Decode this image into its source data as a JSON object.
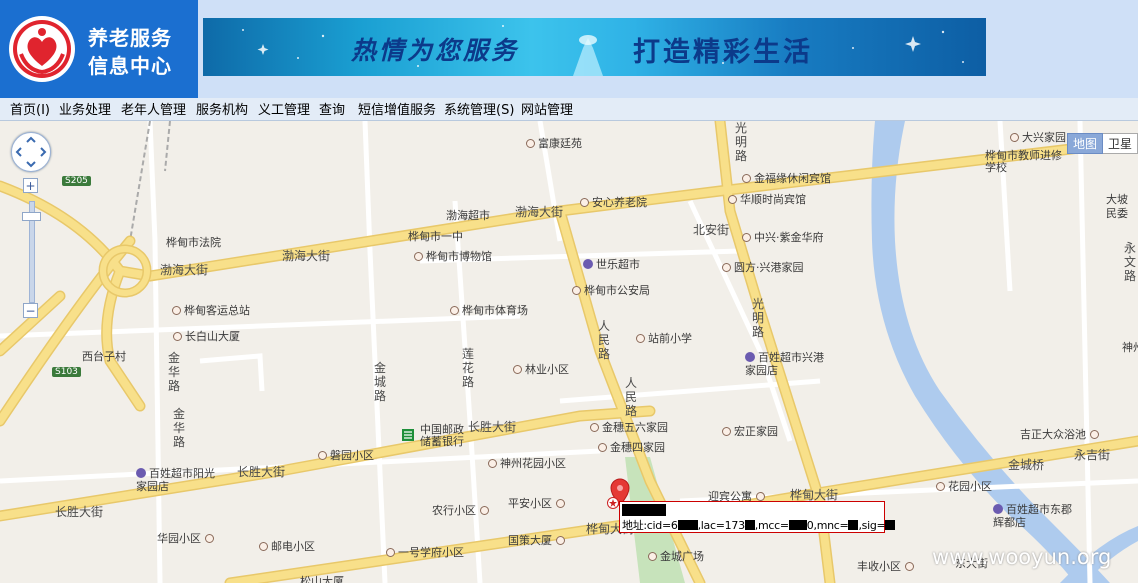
{
  "header": {
    "logo_line1": "养老服务",
    "logo_line2": "信息中心",
    "slogan_left": "热情为您服务",
    "slogan_right": "打造精彩生活"
  },
  "nav": [
    "首页(I)",
    "业务处理",
    "老年人管理",
    "服务机构",
    "义工管理",
    "查询",
    "短信增值服务",
    "系统管理(S)",
    "网站管理"
  ],
  "map": {
    "map_type": "地图",
    "satellite": "卫星",
    "zoom_in": "+",
    "zoom_out": "−",
    "pois": [
      "大兴家园",
      "富康廷苑",
      "桦甸市教师进修学校",
      "金福缘休闲宾馆",
      "安心养老院",
      "华顺时尚宾馆",
      "大坡民委",
      "渤海超市",
      "桦甸市法院",
      "桦甸市一中",
      "中兴·紫金华府",
      "世乐超市",
      "永文路",
      "桦甸市博物馆",
      "圆方·兴港家园",
      "桦甸市公安局",
      "桦甸客运总站",
      "桦甸市体育场",
      "站前小学",
      "长白山大厦",
      "神州",
      "百姓超市兴港家园店",
      "林业小区",
      "中国邮政储蓄银行",
      "金穗五六家园",
      "宏正家园",
      "吉正大众浴池",
      "金穗四家园",
      "磐园小区",
      "神州花园小区",
      "百姓超市阳光家园店",
      "迎宾公寓",
      "花园小区",
      "平安小区",
      "农行小区",
      "百姓超市东郡辉都店",
      "国策大厦",
      "华园小区",
      "邮电小区",
      "一号学府小区",
      "金城广场",
      "丰收小区",
      "东大街",
      "松山大厦"
    ],
    "roads": [
      "渤海大街",
      "渤海大街",
      "渤海大街",
      "北安街",
      "光明路",
      "光明路",
      "人民路",
      "人民路",
      "金华路",
      "金华路",
      "金城路",
      "莲花路",
      "长胜大街",
      "长胜大街",
      "长胜大街",
      "桦甸大街",
      "桦甸大街",
      "永吉街",
      "金城桥",
      "西台子村"
    ],
    "shields": [
      "S205",
      "S103"
    ],
    "marker": {
      "label": "地址:cid=6",
      "lac": ",lac=173",
      "mcc": ",mcc=",
      "mnc": "0,mnc=",
      "sig": ",sig="
    }
  },
  "watermark": "www.wooyun.org",
  "colors": {
    "header_bg": "#cfe0f7",
    "logo_bg": "#1b6fd0",
    "map_bg": "#f2efe9",
    "road_yellow": "#f8e08a",
    "river": "#aecbee",
    "marker_red": "#e53935"
  }
}
